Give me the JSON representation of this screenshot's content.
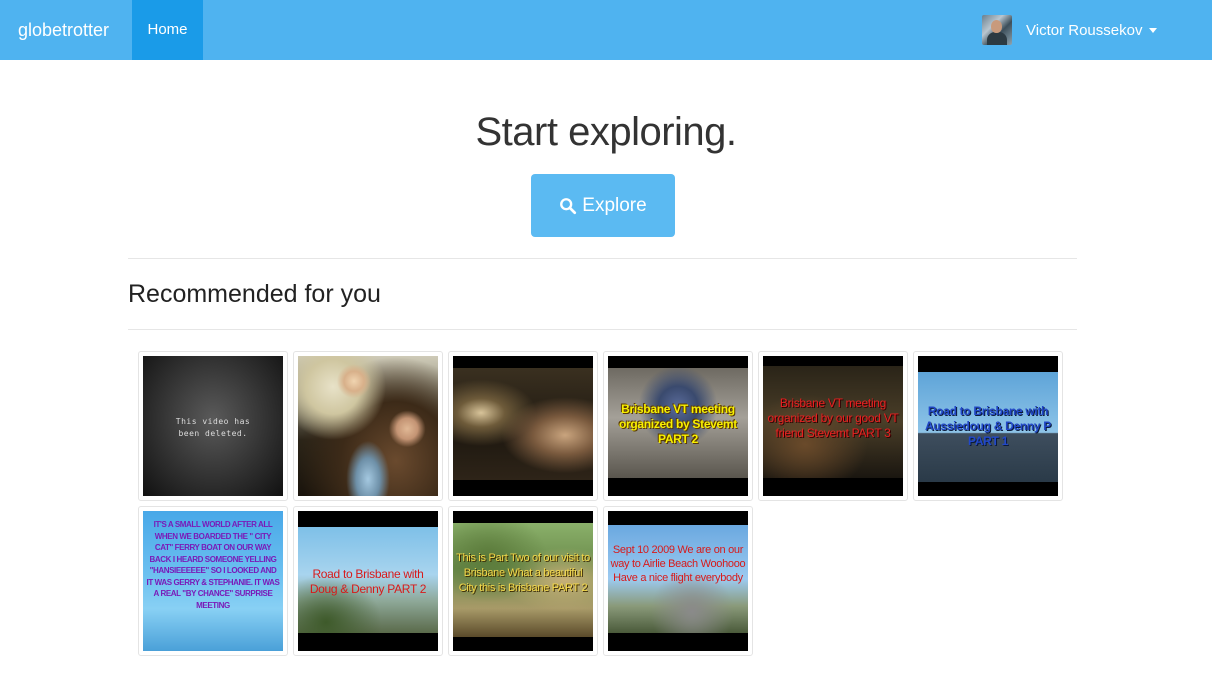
{
  "navbar": {
    "brand": "globetrotter",
    "home_label": "Home",
    "user_name": "Victor Roussekov"
  },
  "hero": {
    "title": "Start exploring.",
    "explore_label": "Explore"
  },
  "section": {
    "title": "Recommended for you"
  },
  "thumbnails": [
    {
      "caption": "This video has been deleted.",
      "style": "deleted"
    },
    {
      "caption": "",
      "style": "party"
    },
    {
      "caption": "",
      "style": "night"
    },
    {
      "caption": "Brisbane VT meeting organized by Stevemt PART 2",
      "style": "yellow-title"
    },
    {
      "caption": "Brisbane VT meeting organized by our good VT friend Stevemt PART 3",
      "style": "red-title"
    },
    {
      "caption": "Road to Brisbane with Aussiedoug & Denny P PART 1",
      "style": "road-sign"
    },
    {
      "caption": "IT'S A SMALL WORLD AFTER ALL WHEN WE BOARDED THE \" CITY CAT\" FERRY BOAT ON OUR WAY BACK I HEARD SOMEONE YELLING \"HANSIEEEEEE\" SO I LOOKED AND IT WAS GERRY & STEPHANIE. IT WAS A REAL \"BY CHANCE\" SURPRISE MEETING",
      "style": "purple-text"
    },
    {
      "caption": "Road to Brisbane with Doug & Denny PART 2",
      "style": "road"
    },
    {
      "caption": "This is Part Two of our visit to Brisbane What a beautiful City this is Brisbane PART 2",
      "style": "trees"
    },
    {
      "caption": "Sept 10 2009 We are on our way to Airlie Beach Woohooo Have a nice flight everybody",
      "style": "beach"
    }
  ],
  "colors": {
    "navbar": "#4fb3f0",
    "home_active": "#1a9be8",
    "button": "#5bbaf2"
  }
}
